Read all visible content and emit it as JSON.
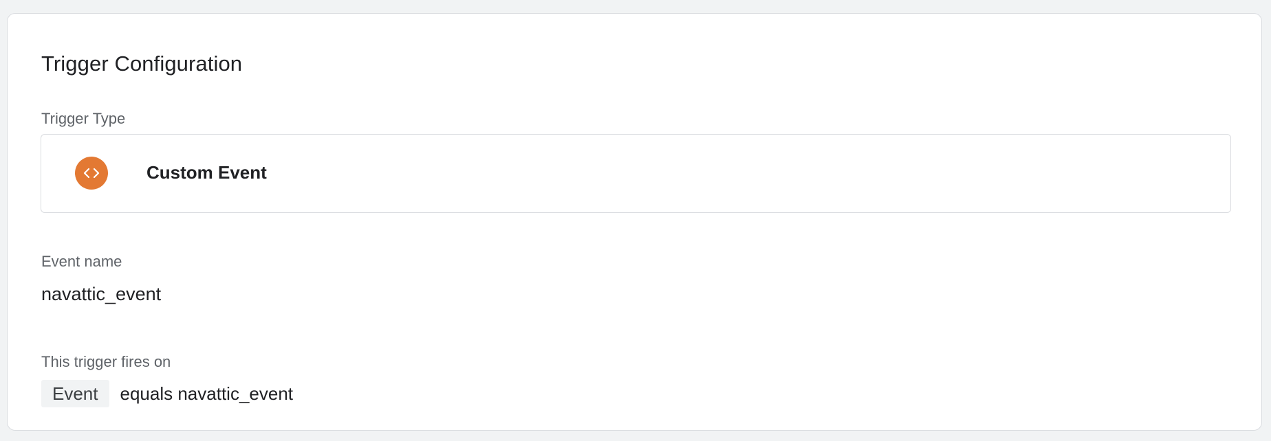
{
  "card": {
    "title": "Trigger Configuration"
  },
  "trigger_type": {
    "label": "Trigger Type",
    "name": "Custom Event",
    "icon": "code-brackets-icon",
    "icon_color": "#e37933"
  },
  "event_name": {
    "label": "Event name",
    "value": "navattic_event"
  },
  "fires_on": {
    "label": "This trigger fires on",
    "variable": "Event",
    "condition": "equals navattic_event"
  }
}
